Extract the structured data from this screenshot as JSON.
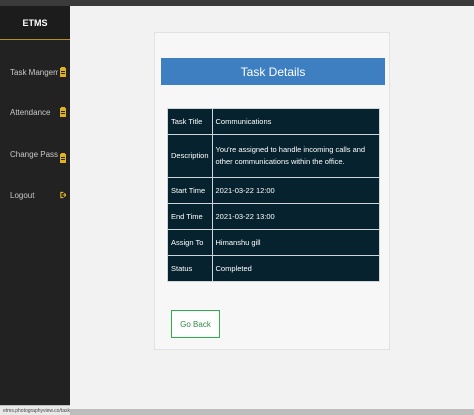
{
  "app": {
    "brand": "ETMS"
  },
  "sidebar": {
    "items": [
      {
        "label": "Task Mangement",
        "icon": "clipboard-icon"
      },
      {
        "label": "Attendance",
        "icon": "clipboard-icon"
      },
      {
        "label": "Change Password",
        "icon": "clipboard-icon"
      },
      {
        "label": "Logout",
        "icon": "logout-icon"
      }
    ]
  },
  "status_bar": {
    "url": "etms.photographyview.co/task-info.php"
  },
  "task_details": {
    "title": "Task Details",
    "rows": [
      {
        "key": "Task Title",
        "value": "Communications"
      },
      {
        "key": "Description",
        "value": "You're assigned to handle incoming calls and other communications within the office."
      },
      {
        "key": "Start Time",
        "value": "2021-03-22 12:00"
      },
      {
        "key": "End Time",
        "value": "2021-03-22 13:00"
      },
      {
        "key": "Assign To",
        "value": "Himanshu gill"
      },
      {
        "key": "Status",
        "value": "Completed"
      }
    ],
    "back_button": "Go Back"
  },
  "colors": {
    "sidebar_bg": "#222222",
    "accent_gold": "#b8901c",
    "title_bar": "#3d7fc1",
    "table_bg": "#06222e",
    "button_border": "#2bb04a"
  }
}
